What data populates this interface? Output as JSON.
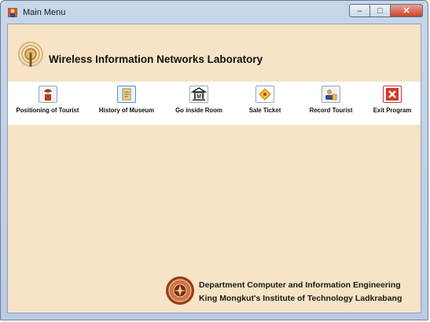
{
  "window": {
    "title": "Main Menu",
    "controls": {
      "minimize": "–",
      "maximize": "□",
      "close": "✕"
    }
  },
  "header": {
    "lab_title": "Wireless Information Networks Laboratory",
    "logo_icon": "antenna-signal-icon"
  },
  "toolbar": {
    "items": [
      {
        "label": "Positioning of Tourist",
        "icon": "tourist-person-icon"
      },
      {
        "label": "History of Museum",
        "icon": "scroll-icon"
      },
      {
        "label": "Go inside Room",
        "icon": "museum-building-icon"
      },
      {
        "label": "Sale Ticket",
        "icon": "ticket-icon"
      },
      {
        "label": "Record Tourist",
        "icon": "record-person-icon"
      },
      {
        "label": "Exit Program",
        "icon": "exit-x-icon"
      }
    ]
  },
  "footer": {
    "department": "Department Computer and Information Engineering",
    "institute": "King Mongkut's Institute of Technology Ladkrabang",
    "seal_icon": "university-seal-icon"
  },
  "colors": {
    "client_bg": "#f7e3c6",
    "toolbar_bg": "#ffffff",
    "exit_red": "#d23a2a"
  }
}
